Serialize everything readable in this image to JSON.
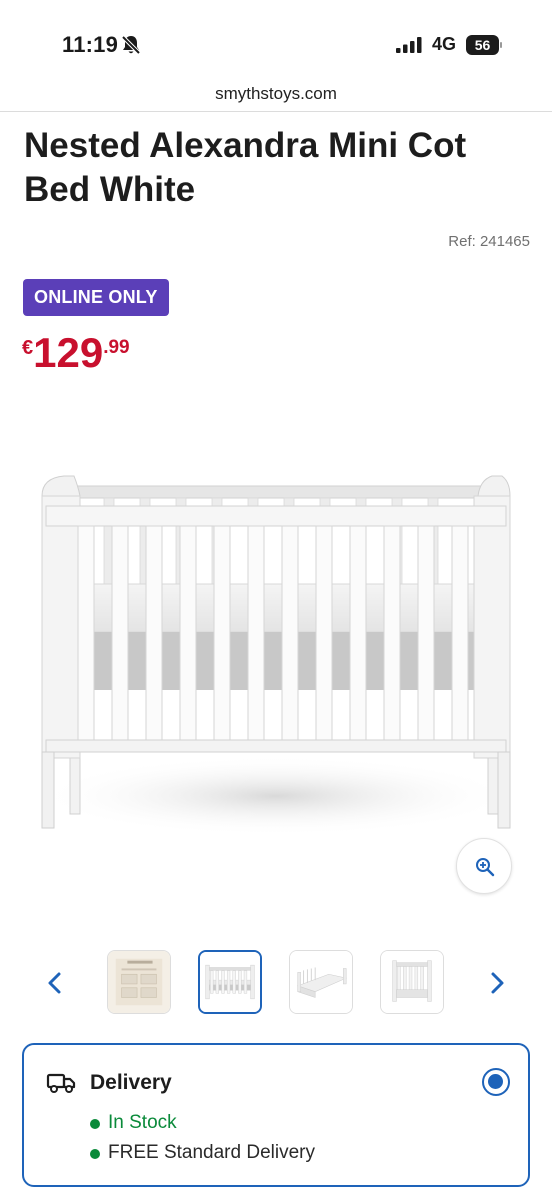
{
  "status_bar": {
    "time": "11:19",
    "network": "4G",
    "battery": "56",
    "icons": [
      "bell-slash-icon",
      "signal-icon",
      "battery-icon"
    ]
  },
  "browser": {
    "url": "smythstoys.com"
  },
  "product": {
    "title": "Nested Alexandra Mini Cot Bed White",
    "ref": "Ref: 241465",
    "badge": "ONLINE ONLY",
    "price": {
      "currency": "€",
      "whole": "129",
      "cents": ".99"
    },
    "image_alt": "white mini cot bed",
    "zoom_icon": "zoom-in-icon"
  },
  "gallery": {
    "prev_icon": "chevron-left-icon",
    "next_icon": "chevron-right-icon",
    "thumbnails": [
      {
        "name": "product-info-thumbnail",
        "selected": false
      },
      {
        "name": "cot-front-thumbnail",
        "selected": true
      },
      {
        "name": "cot-bed-mode-thumbnail",
        "selected": false
      },
      {
        "name": "cot-side-thumbnail",
        "selected": false
      }
    ]
  },
  "delivery": {
    "icon": "truck-icon",
    "title": "Delivery",
    "selected": true,
    "stock": "In Stock",
    "shipping": "FREE Standard Delivery"
  },
  "colors": {
    "badge": "#5b3fb8",
    "price": "#c8102e",
    "accent": "#1e63b9",
    "in_stock": "#0a8a3a"
  }
}
